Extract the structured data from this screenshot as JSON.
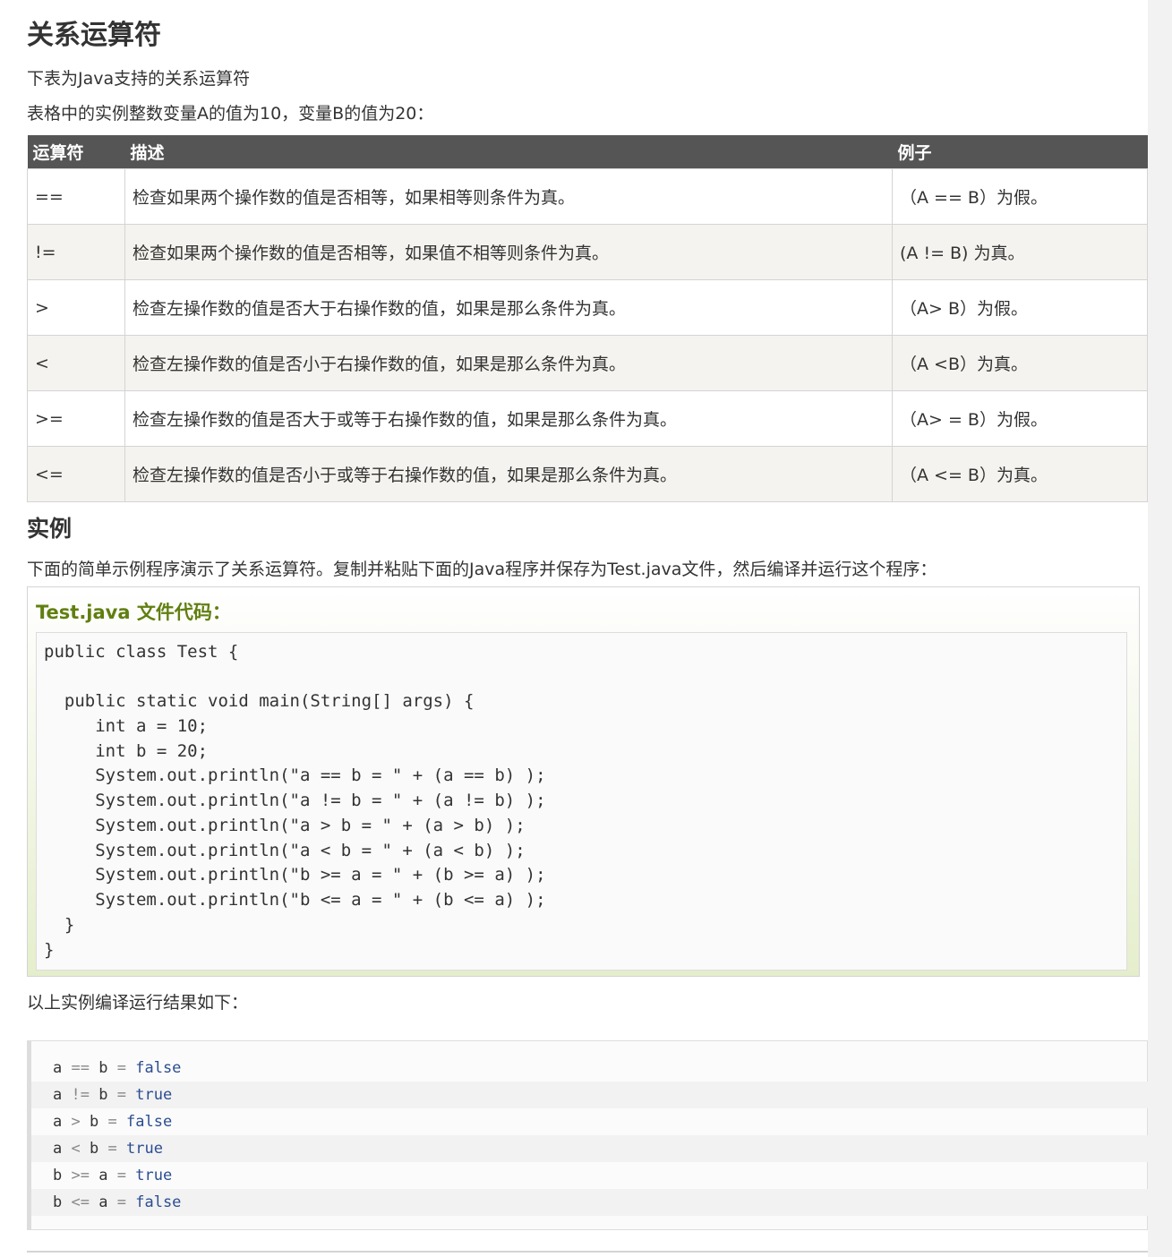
{
  "title": "关系运算符",
  "intro1": "下表为Java支持的关系运算符",
  "intro2": "表格中的实例整数变量A的值为10，变量B的值为20：",
  "table": {
    "headers": [
      "运算符",
      "描述",
      "例子"
    ],
    "rows": [
      [
        "==",
        "检查如果两个操作数的值是否相等，如果相等则条件为真。",
        "（A == B）为假。"
      ],
      [
        "!=",
        "检查如果两个操作数的值是否相等，如果值不相等则条件为真。",
        "(A != B) 为真。"
      ],
      [
        ">",
        "检查左操作数的值是否大于右操作数的值，如果是那么条件为真。",
        "（A> B）为假。"
      ],
      [
        "<",
        "检查左操作数的值是否小于右操作数的值，如果是那么条件为真。",
        "（A <B）为真。"
      ],
      [
        ">=",
        "检查左操作数的值是否大于或等于右操作数的值，如果是那么条件为真。",
        "（A> = B）为假。"
      ],
      [
        "<=",
        "检查左操作数的值是否小于或等于右操作数的值，如果是那么条件为真。",
        "（A <= B）为真。"
      ]
    ]
  },
  "section_title": "实例",
  "section_desc": "下面的简单示例程序演示了关系运算符。复制并粘贴下面的Java程序并保存为Test.java文件，然后编译并运行这个程序：",
  "example": {
    "heading": "Test.java 文件代码：",
    "code_lines": [
      "public class Test {",
      "",
      "  public static void main(String[] args) {",
      "     int a = 10;",
      "     int b = 20;",
      "     System.out.println(\"a == b = \" + (a == b) );",
      "     System.out.println(\"a != b = \" + (a != b) );",
      "     System.out.println(\"a > b = \" + (a > b) );",
      "     System.out.println(\"a < b = \" + (a < b) );",
      "     System.out.println(\"b >= a = \" + (b >= a) );",
      "     System.out.println(\"b <= a = \" + (b <= a) );",
      "  }",
      "}"
    ]
  },
  "result_intro": "以上实例编译运行结果如下：",
  "output": [
    {
      "lhs": "a",
      "op": "==",
      "rhs": "b",
      "eq": "=",
      "val": "false"
    },
    {
      "lhs": "a",
      "op": "!=",
      "rhs": "b",
      "eq": "=",
      "val": "true"
    },
    {
      "lhs": "a",
      "op": ">",
      "rhs": "b",
      "eq": "=",
      "val": "false"
    },
    {
      "lhs": "a",
      "op": "<",
      "rhs": "b",
      "eq": "=",
      "val": "true"
    },
    {
      "lhs": "b",
      "op": ">=",
      "rhs": "a",
      "eq": "=",
      "val": "true"
    },
    {
      "lhs": "b",
      "op": "<=",
      "rhs": "a",
      "eq": "=",
      "val": "false"
    }
  ],
  "colors": {
    "header_bg": "#555555",
    "example_heading": "#617f10",
    "keyword": "#006400",
    "string": "#b22222",
    "number": "#8b0000"
  }
}
